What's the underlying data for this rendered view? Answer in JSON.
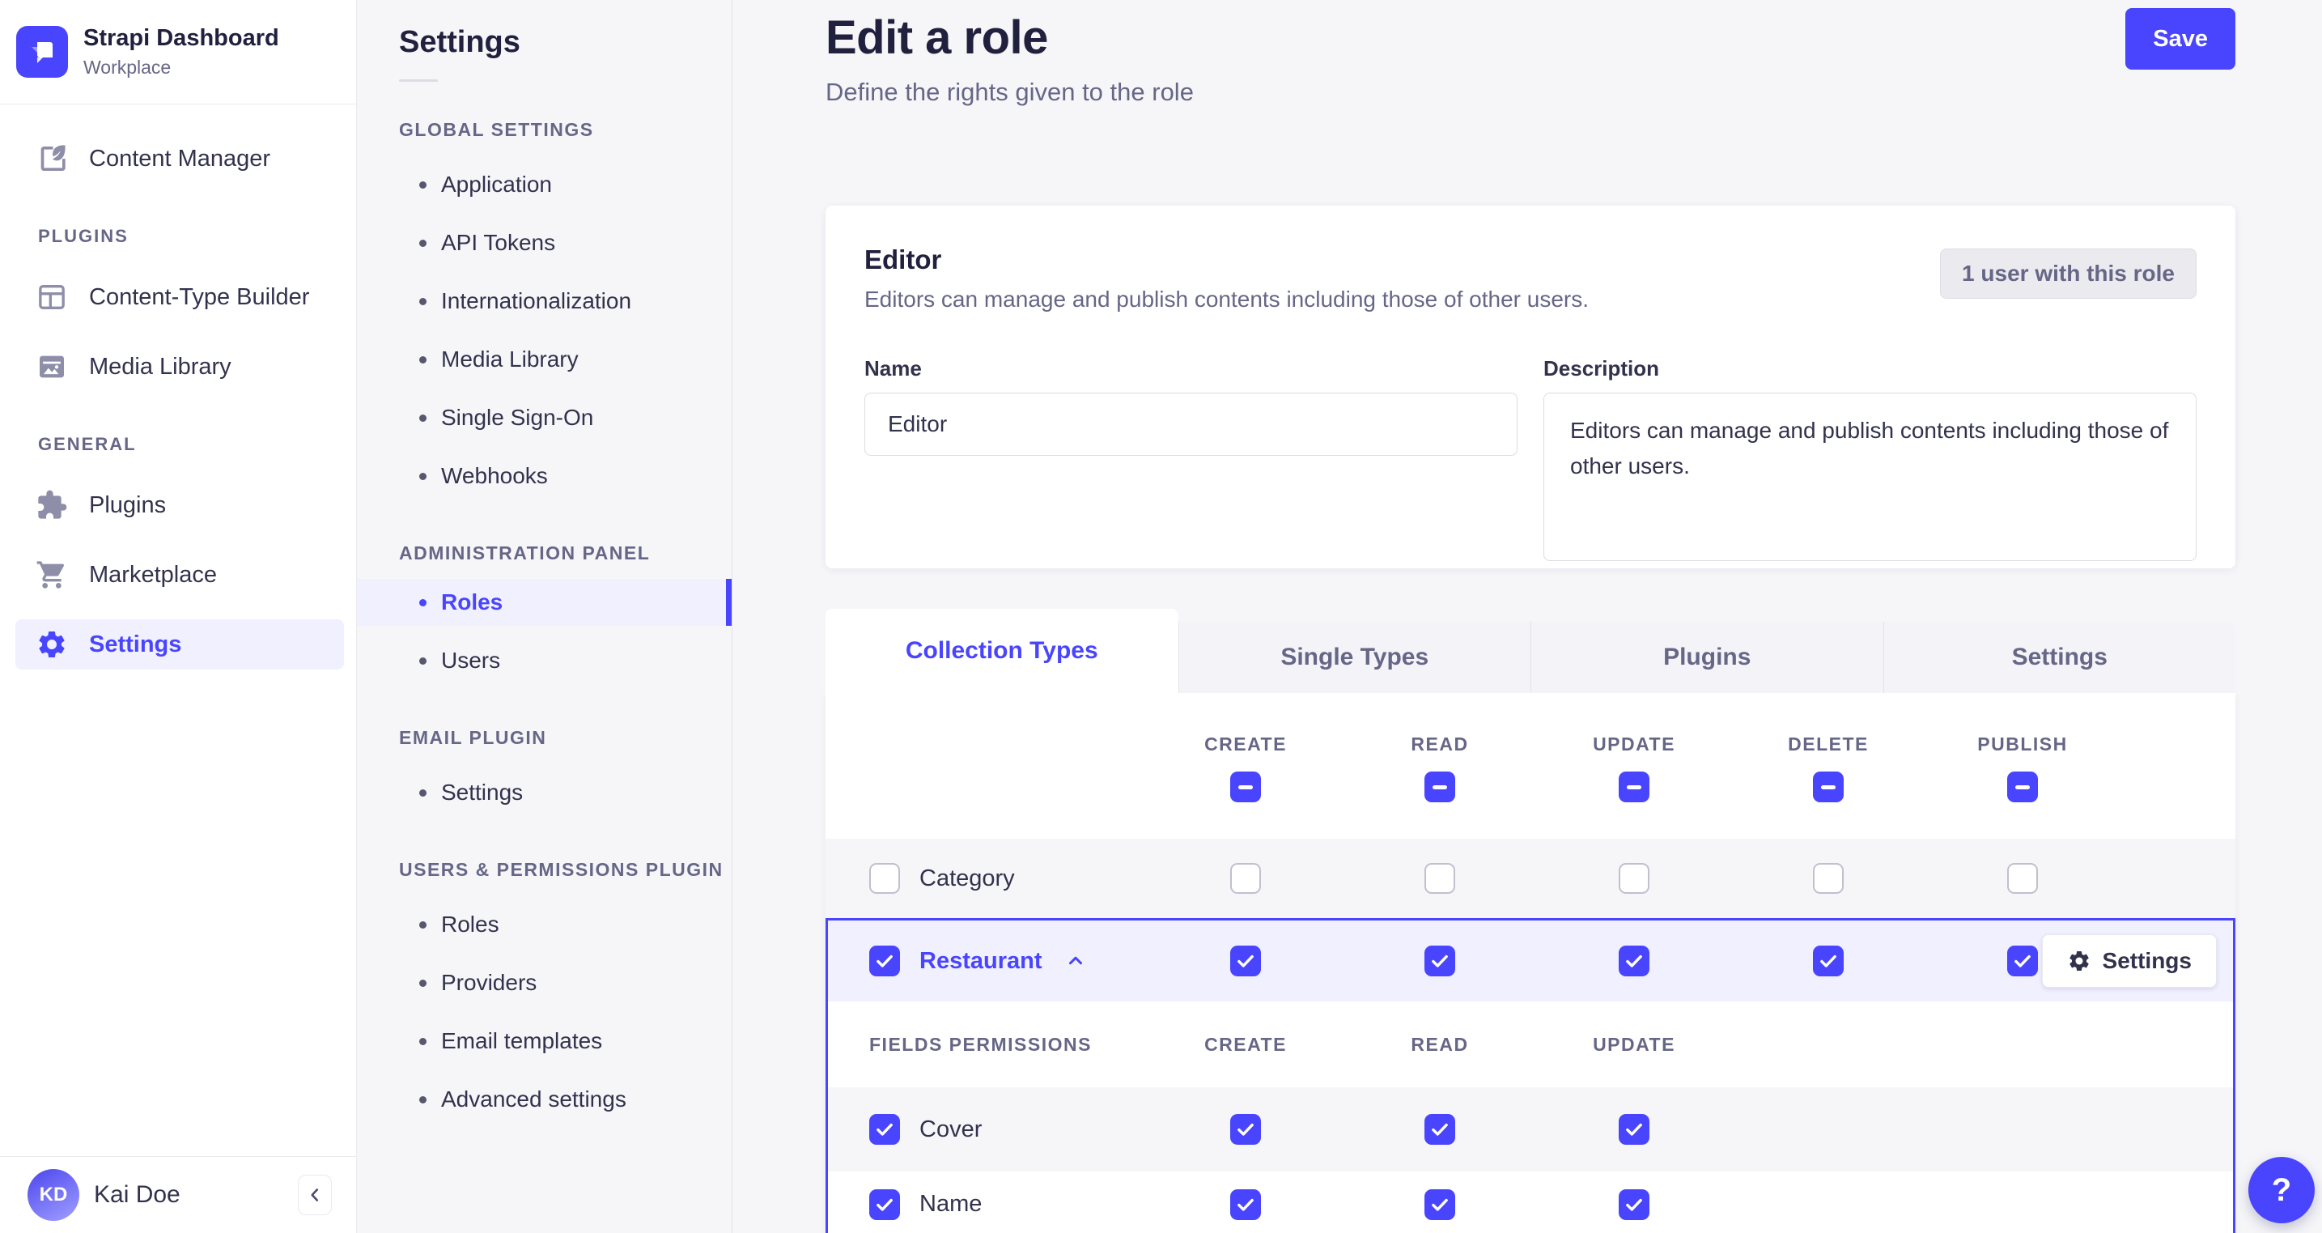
{
  "brand": {
    "title": "Strapi Dashboard",
    "subtitle": "Workplace"
  },
  "nav": {
    "content_manager": "Content Manager",
    "sections": [
      {
        "title": "PLUGINS",
        "items": [
          {
            "label": "Content-Type Builder"
          },
          {
            "label": "Media Library"
          }
        ]
      },
      {
        "title": "GENERAL",
        "items": [
          {
            "label": "Plugins"
          },
          {
            "label": "Marketplace"
          },
          {
            "label": "Settings",
            "active": true
          }
        ]
      }
    ],
    "user": {
      "initials": "KD",
      "name": "Kai Doe"
    }
  },
  "subnav": {
    "title": "Settings",
    "sections": [
      {
        "title": "GLOBAL SETTINGS",
        "items": [
          {
            "label": "Application"
          },
          {
            "label": "API Tokens"
          },
          {
            "label": "Internationalization"
          },
          {
            "label": "Media Library"
          },
          {
            "label": "Single Sign-On"
          },
          {
            "label": "Webhooks"
          }
        ]
      },
      {
        "title": "ADMINISTRATION PANEL",
        "items": [
          {
            "label": "Roles",
            "active": true
          },
          {
            "label": "Users"
          }
        ]
      },
      {
        "title": "EMAIL PLUGIN",
        "items": [
          {
            "label": "Settings"
          }
        ]
      },
      {
        "title": "USERS & PERMISSIONS PLUGIN",
        "items": [
          {
            "label": "Roles"
          },
          {
            "label": "Providers"
          },
          {
            "label": "Email templates"
          },
          {
            "label": "Advanced settings"
          }
        ]
      }
    ]
  },
  "header": {
    "title": "Edit a role",
    "subtitle": "Define the rights given to the role",
    "save_label": "Save"
  },
  "role_card": {
    "title": "Editor",
    "subtitle": "Editors can manage and publish contents including those of other users.",
    "users_button_label": "1 user with this role",
    "name_label": "Name",
    "name_value": "Editor",
    "description_label": "Description",
    "description_value": "Editors can manage and publish contents including those of other users."
  },
  "permissions": {
    "tabs": [
      {
        "label": "Collection Types",
        "active": true
      },
      {
        "label": "Single Types",
        "active": false
      },
      {
        "label": "Plugins",
        "active": false
      },
      {
        "label": "Settings",
        "active": false
      }
    ],
    "columns": [
      "CREATE",
      "READ",
      "UPDATE",
      "DELETE",
      "PUBLISH"
    ],
    "column_select_all_state": "indeterminate",
    "rows": [
      {
        "label": "Category",
        "selected": false,
        "expanded": false,
        "create": false,
        "read": false,
        "update": false,
        "delete": false,
        "publish": false
      },
      {
        "label": "Restaurant",
        "selected": true,
        "expanded": true,
        "create": true,
        "read": true,
        "update": true,
        "delete": true,
        "publish": true,
        "settings_button_label": "Settings"
      }
    ],
    "fields": {
      "title": "FIELDS PERMISSIONS",
      "columns": [
        "CREATE",
        "READ",
        "UPDATE"
      ],
      "rows": [
        {
          "label": "Cover",
          "create": true,
          "read": true,
          "update": true
        },
        {
          "label": "Name",
          "create": true,
          "read": true,
          "update": true
        }
      ]
    }
  },
  "help": {
    "label": "?"
  },
  "colors": {
    "primary": "#4945ff",
    "primary_bg": "#f0f0ff",
    "text": "#32324d",
    "text_secondary": "#666687",
    "page_bg": "#f6f6f9"
  }
}
